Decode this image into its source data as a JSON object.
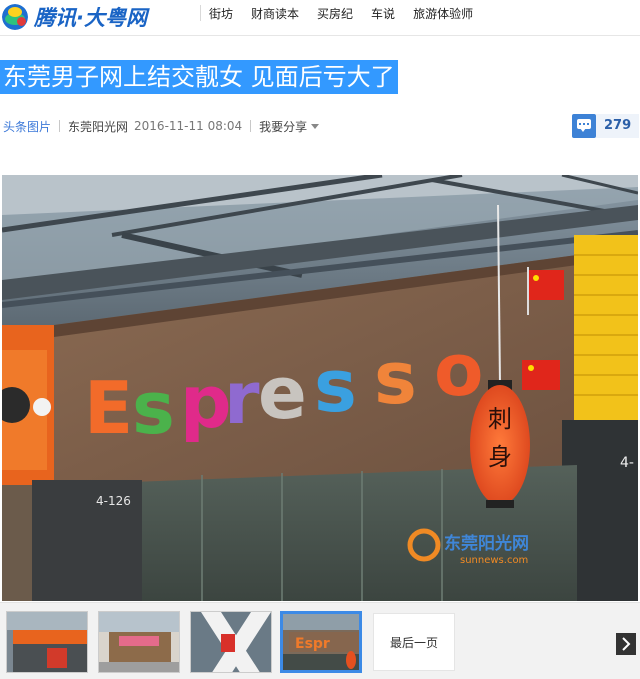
{
  "header": {
    "logo_text": "腾讯·大粤网",
    "nav": [
      "街坊",
      "财商读本",
      "买房纪",
      "车说",
      "旅游体验师"
    ]
  },
  "article": {
    "title": "东莞男子网上结交靓女 见面后亏大了",
    "category": "头条图片",
    "source": "东莞阳光网",
    "date": "2016-11-11 08:04",
    "share_label": "我要分享",
    "comment_count": "279"
  },
  "photo": {
    "sign_letters": [
      "E",
      "s",
      "p",
      "r",
      "e",
      "s",
      "s",
      "o"
    ],
    "unit_number": "4-126",
    "side_number": "4-",
    "lantern_text": [
      "刺",
      "身"
    ],
    "watermark": "东莞阳光网",
    "watermark_sub": "sunnews.com"
  },
  "gallery": {
    "last_page_label": "最后一页",
    "active_index": 3,
    "thumbnail_count": 4
  },
  "colors": {
    "accent_blue": "#3399ff",
    "link_blue": "#3b78d8",
    "active_border": "#3c8ae6"
  }
}
